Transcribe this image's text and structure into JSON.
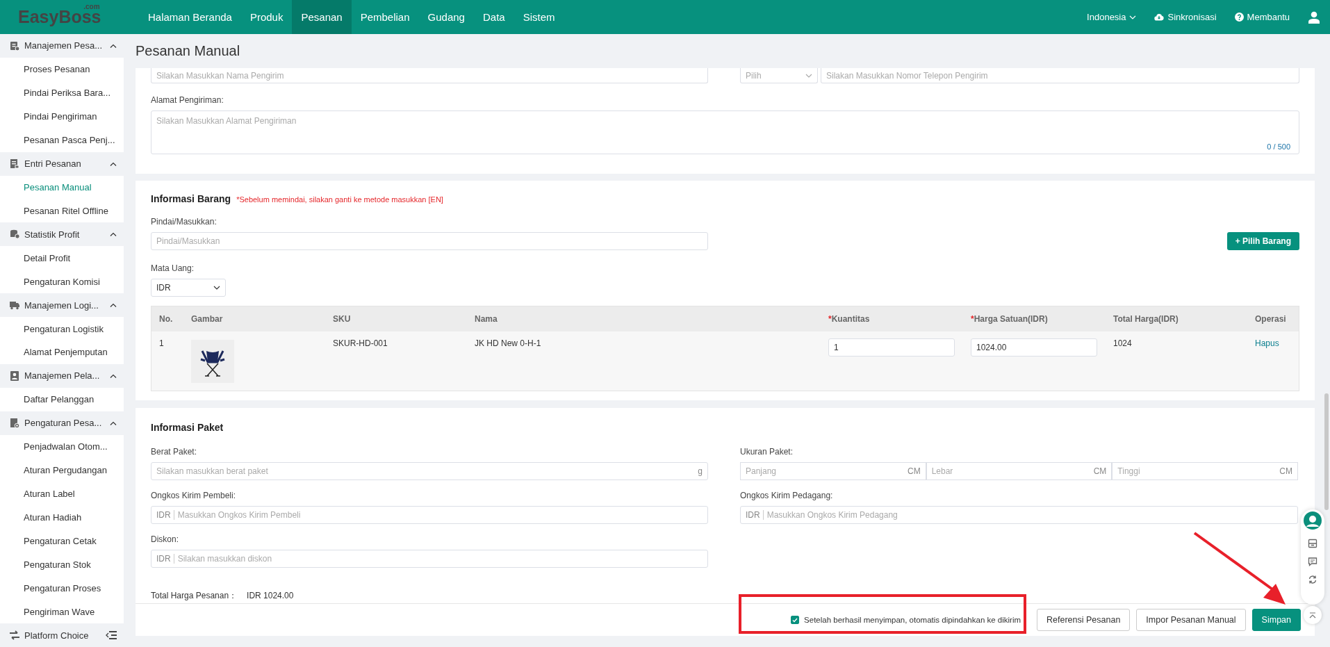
{
  "header": {
    "logo": "EasyBoss",
    "logo_suffix": ".com",
    "nav": [
      {
        "label": "Halaman Beranda",
        "selected": false
      },
      {
        "label": "Produk",
        "selected": false
      },
      {
        "label": "Pesanan",
        "selected": true
      },
      {
        "label": "Pembelian",
        "selected": false
      },
      {
        "label": "Gudang",
        "selected": false
      },
      {
        "label": "Data",
        "selected": false
      },
      {
        "label": "Sistem",
        "selected": false
      }
    ],
    "language": "Indonesia",
    "sync": "Sinkronisasi",
    "help": "Membantu"
  },
  "sidebar": {
    "groups": [
      {
        "label": "Manajemen Pesa...",
        "expanded": true,
        "items": [
          {
            "label": "Proses Pesanan",
            "selected": false
          },
          {
            "label": "Pindai Periksa Bara...",
            "selected": false
          },
          {
            "label": "Pindai Pengiriman",
            "selected": false
          },
          {
            "label": "Pesanan Pasca Penj...",
            "selected": false
          }
        ]
      },
      {
        "label": "Entri Pesanan",
        "expanded": true,
        "items": [
          {
            "label": "Pesanan Manual",
            "selected": true
          },
          {
            "label": "Pesanan Ritel Offline",
            "selected": false
          }
        ]
      },
      {
        "label": "Statistik Profit",
        "expanded": true,
        "items": [
          {
            "label": "Detail Profit",
            "selected": false
          },
          {
            "label": "Pengaturan Komisi",
            "selected": false
          }
        ]
      },
      {
        "label": "Manajemen Logi...",
        "expanded": true,
        "items": [
          {
            "label": "Pengaturan Logistik",
            "selected": false
          },
          {
            "label": "Alamat Penjemputan",
            "selected": false
          }
        ]
      },
      {
        "label": "Manajemen Pela...",
        "expanded": true,
        "items": [
          {
            "label": "Daftar Pelanggan",
            "selected": false
          }
        ]
      },
      {
        "label": "Pengaturan Pesa...",
        "expanded": true,
        "items": [
          {
            "label": "Penjadwalan Otom...",
            "selected": false
          },
          {
            "label": "Aturan Pergudangan",
            "selected": false
          },
          {
            "label": "Aturan Label",
            "selected": false
          },
          {
            "label": "Aturan Hadiah",
            "selected": false
          },
          {
            "label": "Pengaturan Cetak",
            "selected": false
          },
          {
            "label": "Pengaturan Stok",
            "selected": false
          },
          {
            "label": "Pengaturan Proses",
            "selected": false
          },
          {
            "label": "Pengiriman Wave",
            "selected": false
          }
        ]
      }
    ],
    "footer": "Platform Choice"
  },
  "page_title": "Pesanan Manual",
  "sender": {
    "name_placeholder": "Silakan Masukkan Nama Pengirim",
    "phone_code": "Pilih",
    "phone_placeholder": "Silakan Masukkan Nomor Telepon Pengirim",
    "address_label": "Alamat Pengiriman:",
    "address_placeholder": "Silakan Masukkan Alamat Pengiriman",
    "address_counter": "0 / 500"
  },
  "items_section": {
    "title": "Informasi Barang",
    "hint": "*Sebelum memindai, silakan ganti ke metode masukkan [EN]",
    "scan_label": "Pindai/Masukkan:",
    "scan_placeholder": "Pindai/Masukkan",
    "add_button": "+ Pilih Barang",
    "currency_label": "Mata Uang:",
    "currency": "IDR",
    "columns": [
      {
        "label": "No."
      },
      {
        "label": "Gambar"
      },
      {
        "label": "SKU"
      },
      {
        "label": "Nama"
      },
      {
        "label": "Kuantitas",
        "required_mark": "*"
      },
      {
        "label": "Harga Satuan(IDR)",
        "required_mark": "*"
      },
      {
        "label": "Total Harga(IDR)"
      },
      {
        "label": "Operasi"
      }
    ],
    "rows": [
      {
        "no": "1",
        "sku": "SKUR-HD-001",
        "name": "JK HD New 0-H-1",
        "quantity": "1",
        "unit_price": "1024.00",
        "total": "1024",
        "action": "Hapus"
      }
    ]
  },
  "package_section": {
    "title": "Informasi Paket",
    "fields": [
      {
        "kind": "unit",
        "label": "Berat Paket:",
        "placeholder": "Silakan masukkan berat paket",
        "unit": "g"
      },
      {
        "kind": "dimensions",
        "label": "Ukuran Paket:",
        "parts": [
          {
            "placeholder": "Panjang",
            "unit": "CM"
          },
          {
            "placeholder": "Lebar",
            "unit": "CM"
          },
          {
            "placeholder": "Tinggi",
            "unit": "CM"
          }
        ]
      },
      {
        "kind": "currency",
        "label": "Ongkos Kirim Pembeli:",
        "prefix": "IDR",
        "placeholder": "Masukkan Ongkos Kirim Pembeli"
      },
      {
        "kind": "currency",
        "label": "Ongkos Kirim Pedagang:",
        "prefix": "IDR",
        "placeholder": "Masukkan Ongkos Kirim Pedagang"
      },
      {
        "kind": "currency",
        "label": "Diskon:",
        "prefix": "IDR",
        "placeholder": "Silakan masukkan diskon"
      }
    ]
  },
  "total": {
    "label": "Total Harga Pesanan：",
    "value": "IDR 1024.00"
  },
  "footer": {
    "auto_move": {
      "label": "Setelah berhasil menyimpan, otomatis dipindahkan ke dikirim",
      "checked": true
    },
    "buttons": [
      {
        "label": "Referensi Pesanan",
        "kind": "default"
      },
      {
        "label": "Impor Pesanan Manual",
        "kind": "default"
      },
      {
        "label": "Simpan",
        "kind": "primary"
      }
    ]
  }
}
